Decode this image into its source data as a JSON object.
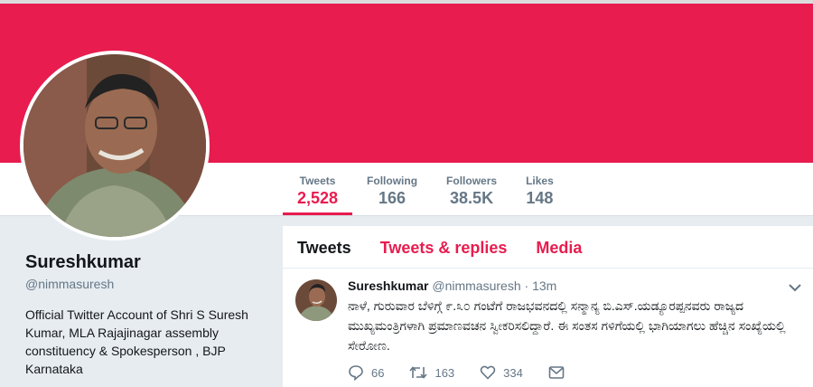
{
  "colors": {
    "accent": "#e81c4f",
    "muted": "#657786",
    "text": "#14171a"
  },
  "stats": [
    {
      "label": "Tweets",
      "value": "2,528"
    },
    {
      "label": "Following",
      "value": "166"
    },
    {
      "label": "Followers",
      "value": "38.5K"
    },
    {
      "label": "Likes",
      "value": "148"
    }
  ],
  "profile": {
    "name": "Sureshkumar",
    "handle": "@nimmasuresh",
    "bio": "Official Twitter Account of Shri S Suresh Kumar, MLA Rajajinagar assembly constituency & Spokesperson , BJP Karnataka"
  },
  "tabs": [
    {
      "label": "Tweets"
    },
    {
      "label": "Tweets & replies"
    },
    {
      "label": "Media"
    }
  ],
  "tweet": {
    "name": "Sureshkumar",
    "handle": "@nimmasuresh",
    "separator": "·",
    "time": "13m",
    "text": "ನಾಳೆ, ಗುರುವಾರ ಬೆಳಿಗ್ಗೆ ೯.೩೦ ಗಂಟೆಗೆ ರಾಜಭವನದಲ್ಲಿ ಸನ್ಮಾನ್ಯ ಬಿ.ಎಸ್.ಯಡ್ಯೂರಪ್ಪನವರು ರಾಜ್ಯದ ಮುಖ್ಯಮಂತ್ರಿಗಳಾಗಿ ಪ್ರಮಾಣವಚನ ಸ್ವೀಕರಿಸಲಿದ್ದಾರೆ. ಈ ಸಂತಸ ಗಳಿಗೆಯಲ್ಲಿ ಭಾಗಿಯಾಗಲು ಹೆಚ್ಚಿನ ಸಂಖ್ಯೆಯಲ್ಲಿ ಸೇರೋಣ.",
    "replies": "66",
    "retweets": "163",
    "likes": "334"
  }
}
